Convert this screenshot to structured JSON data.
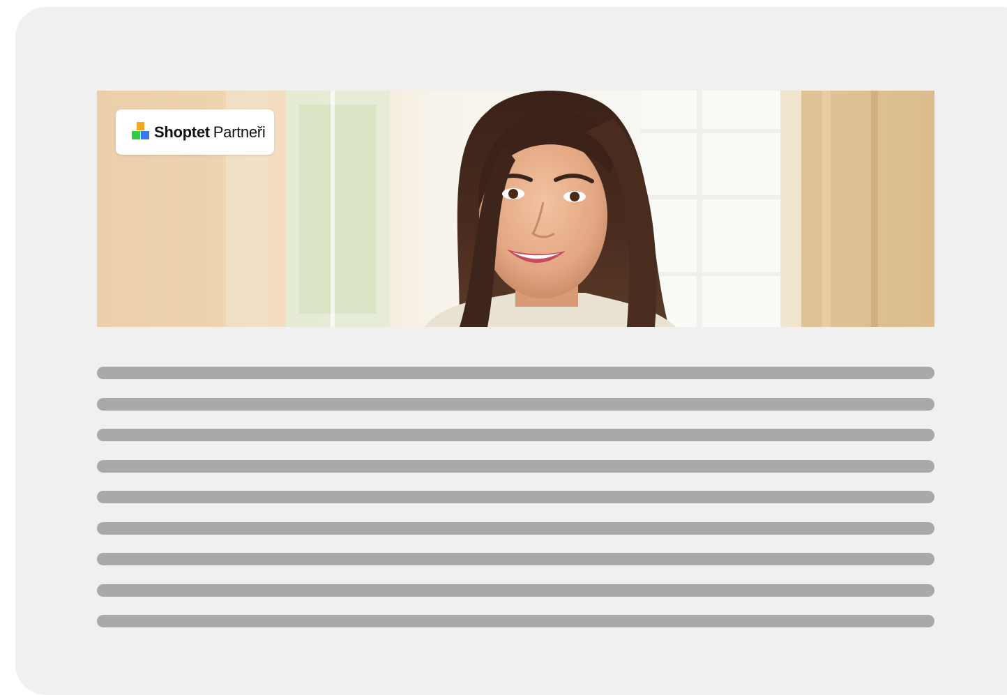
{
  "logo": {
    "brand": "Shoptet",
    "sub": "Partneři"
  },
  "hero": {
    "image": "smiling-woman-portrait-photo"
  },
  "content": {
    "placeholder_lines": 9
  },
  "colors": {
    "card_background": "#f0f0f0",
    "placeholder_line": "#a9a9a9",
    "logo_square_yellow": "#f5a623",
    "logo_square_green": "#2ecc40",
    "logo_square_blue": "#3a78f2"
  }
}
